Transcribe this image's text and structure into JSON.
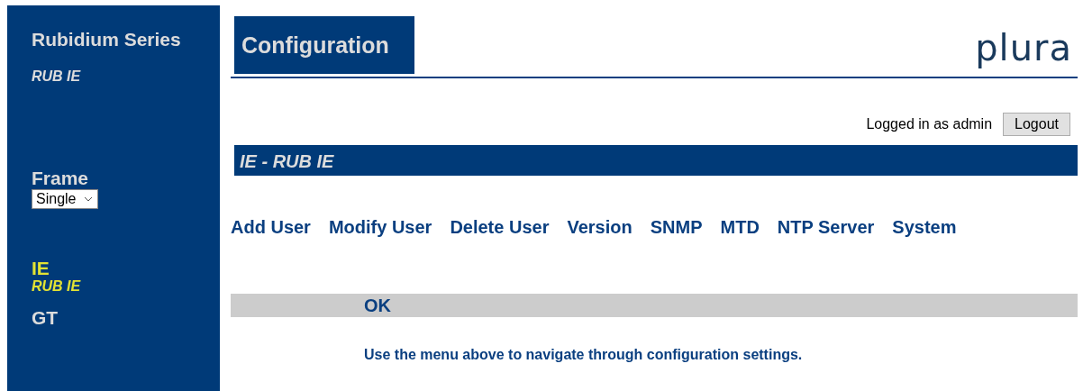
{
  "sidebar": {
    "series": "Rubidium Series",
    "model": "RUB IE",
    "frame_label": "Frame",
    "frame_select": {
      "value": "Single"
    },
    "devices": [
      {
        "name": "IE",
        "subtitle": "RUB IE",
        "selected": true
      },
      {
        "name": "GT",
        "selected": false
      }
    ]
  },
  "header": {
    "title": "Configuration",
    "logo": "plura"
  },
  "session": {
    "text": "Logged in as admin",
    "button": "Logout"
  },
  "device_bar": "IE - RUB IE",
  "menu": [
    "Add User",
    "Modify User",
    "Delete User",
    "Version",
    "SNMP",
    "MTD",
    "NTP Server",
    "System"
  ],
  "status": "OK",
  "message": "Use the menu above to navigate through configuration settings."
}
